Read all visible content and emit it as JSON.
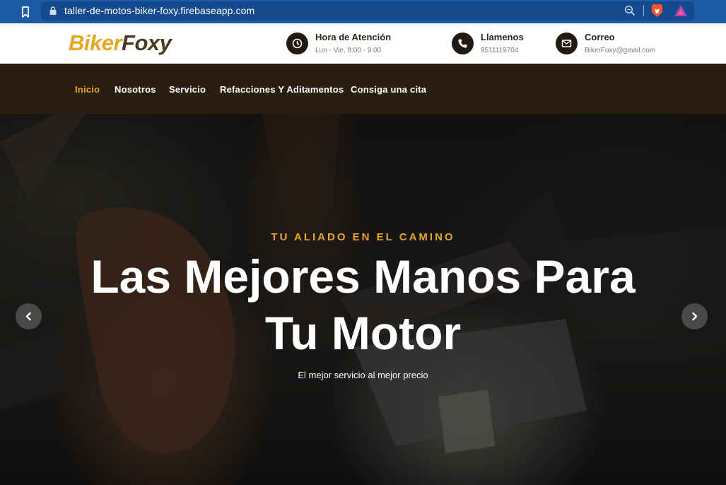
{
  "browser": {
    "url": "taller-de-motos-biker-foxy.firebaseapp.com",
    "icons": [
      "bookmark-icon",
      "lock-icon",
      "zoom-icon",
      "brave-shield-icon",
      "brave-rewards-icon"
    ]
  },
  "header": {
    "logo_part1": "Biker",
    "logo_part2": "Foxy",
    "info": [
      {
        "icon": "clock-icon",
        "title": "Hora de Atención",
        "value": "Lun - Vie, 8:00 - 9:00"
      },
      {
        "icon": "phone-icon",
        "title": "Llamenos",
        "value": "9511119704"
      },
      {
        "icon": "envelope-icon",
        "title": "Correo",
        "value": "BikerFoxy@gmail.com"
      }
    ]
  },
  "nav": {
    "items": [
      {
        "label": "Inicio",
        "active": true
      },
      {
        "label": "Nosotros"
      },
      {
        "label": "Servicio"
      },
      {
        "label": "Refacciones Y Aditamentos"
      },
      {
        "label": "Consiga una cita"
      }
    ]
  },
  "hero": {
    "subtitle": "TU ALIADO EN EL CAMINO",
    "title_line1": "Las Mejores Manos Para",
    "title_line2": "Tu Motor",
    "description": "El mejor servicio al mejor precio"
  },
  "colors": {
    "accent": "#e8a521",
    "brand_dark": "#4b3a1f",
    "nav_bg": "#2a1e10",
    "browser_bar": "#1f5aa6"
  }
}
